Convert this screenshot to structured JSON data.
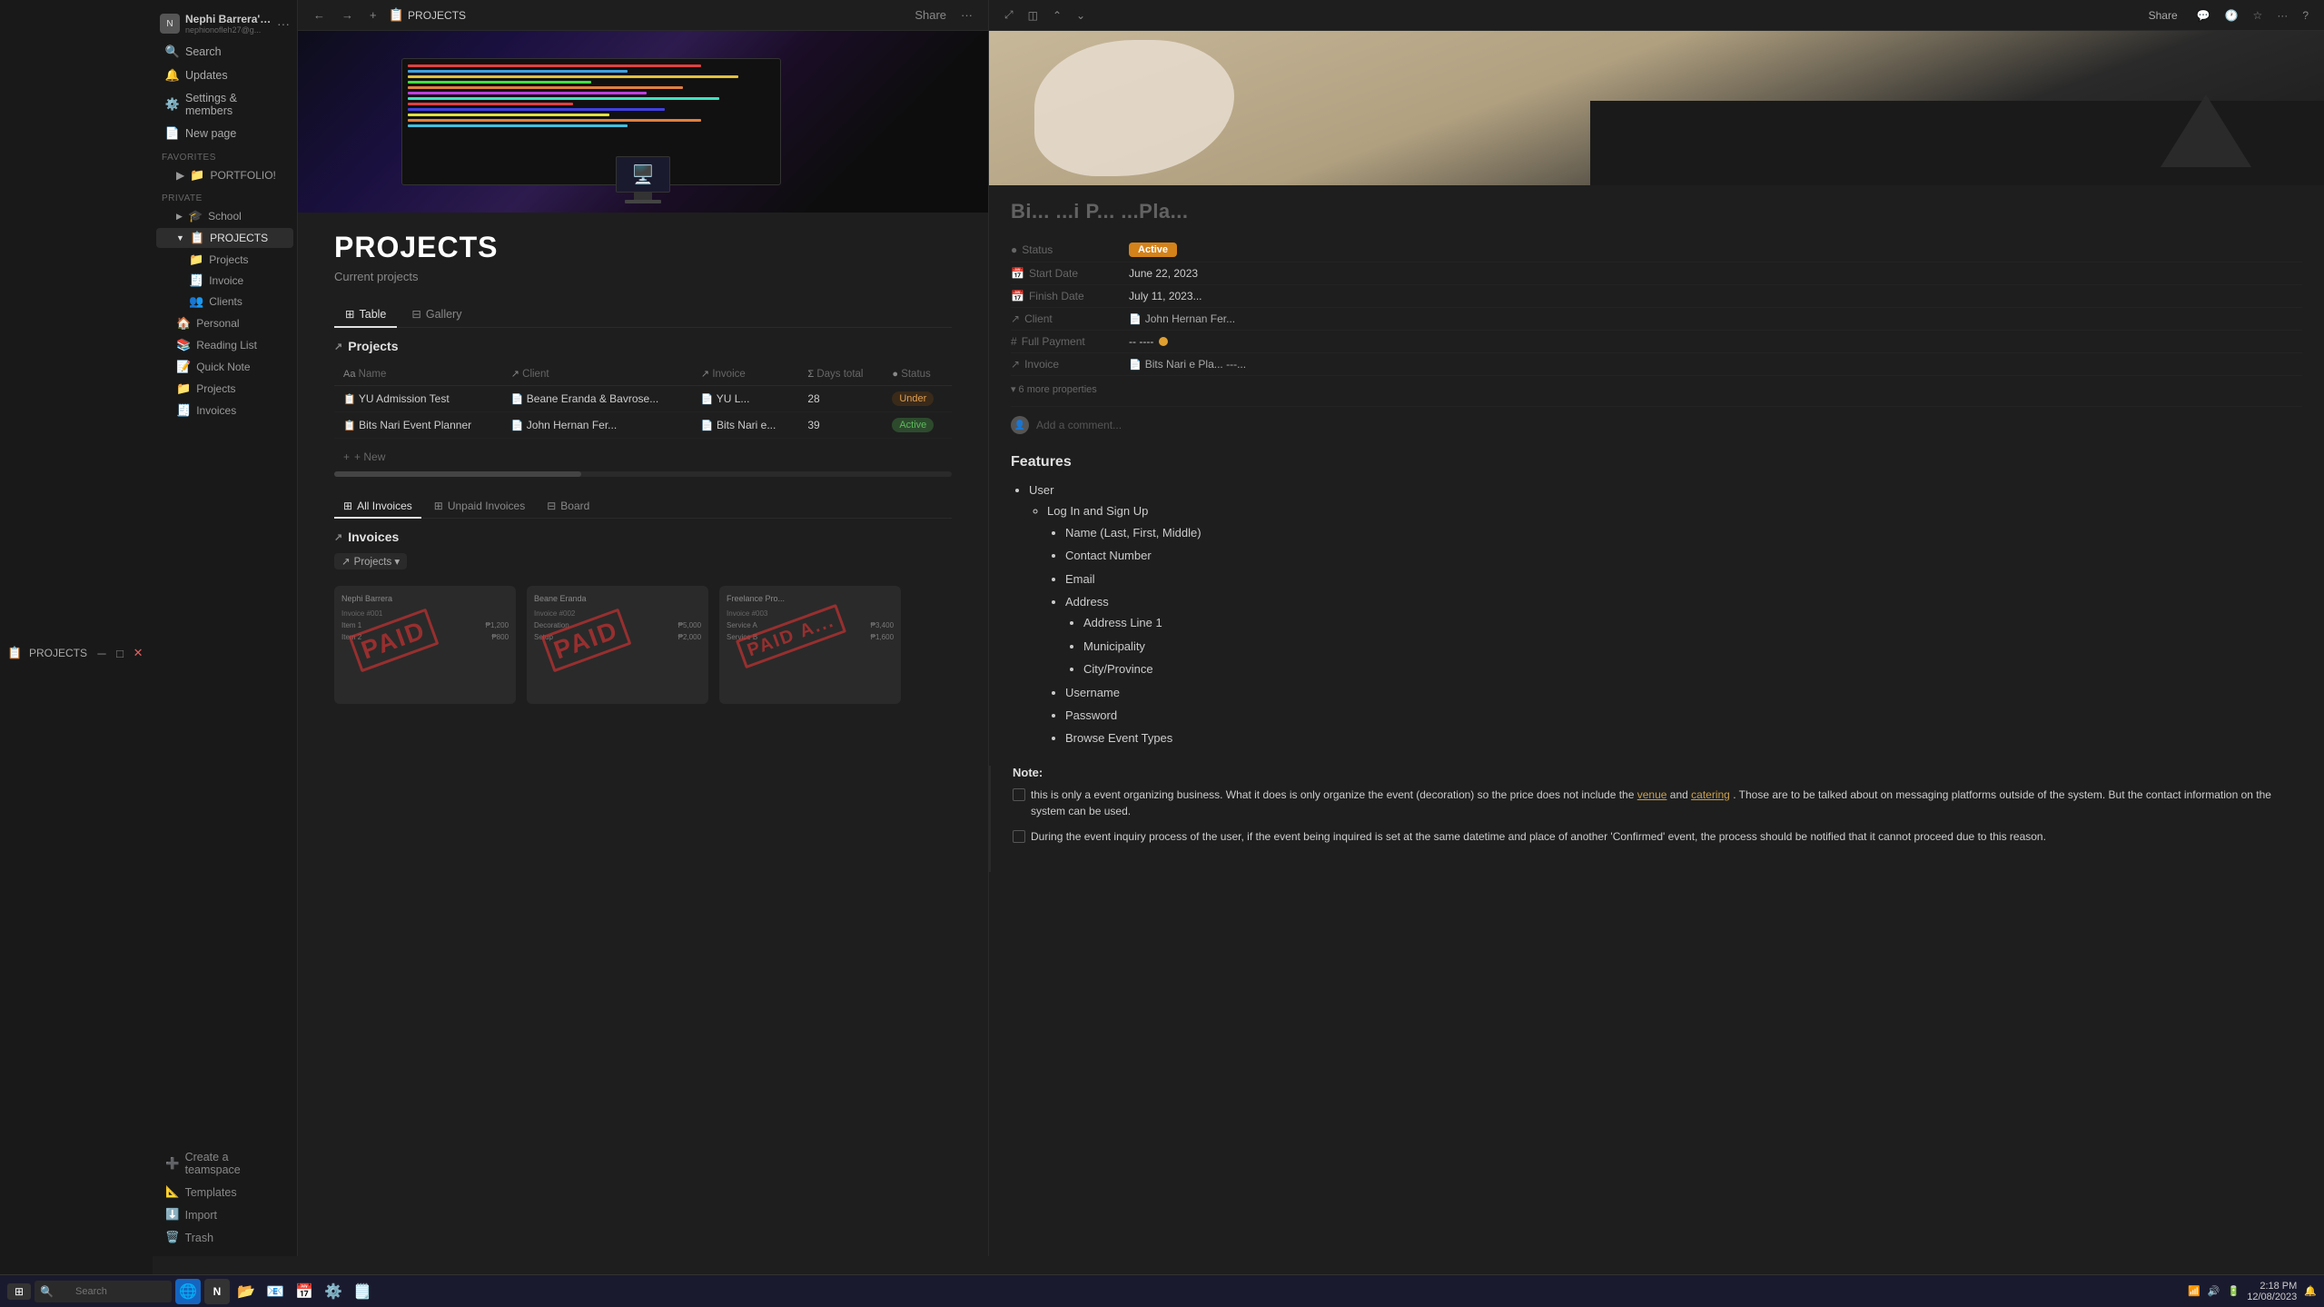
{
  "window": {
    "title": "PROJECTS",
    "app_name": "PROJECTS"
  },
  "sidebar": {
    "workspace": {
      "name": "Nephi Barrera's ...",
      "email": "nephionofleh27@g..."
    },
    "top_items": [
      {
        "id": "search",
        "label": "Search",
        "icon": "🔍"
      },
      {
        "id": "updates",
        "label": "Updates",
        "icon": "🔔"
      },
      {
        "id": "settings",
        "label": "Settings & members",
        "icon": "⚙️"
      },
      {
        "id": "new-page",
        "label": "New page",
        "icon": "📄"
      }
    ],
    "favorites_label": "Favorites",
    "favorites": [
      {
        "id": "portfolio",
        "label": "PORTFOLIO!",
        "icon": "📁"
      }
    ],
    "private_label": "Private",
    "private_items": [
      {
        "id": "school",
        "label": "School",
        "icon": "🎓"
      },
      {
        "id": "projects",
        "label": "PROJECTS",
        "icon": "📋",
        "active": true
      },
      {
        "id": "projects-sub",
        "label": "Projects",
        "icon": "📁"
      },
      {
        "id": "invoice",
        "label": "Invoice",
        "icon": "🧾"
      },
      {
        "id": "clients",
        "label": "Clients",
        "icon": "👥"
      },
      {
        "id": "personal",
        "label": "Personal",
        "icon": "🏠"
      },
      {
        "id": "reading-list",
        "label": "Reading List",
        "icon": "📚"
      },
      {
        "id": "quick-note",
        "label": "Quick Note",
        "icon": "📝"
      },
      {
        "id": "projects2",
        "label": "Projects",
        "icon": "📁"
      },
      {
        "id": "invoices",
        "label": "Invoices",
        "icon": "🧾"
      }
    ],
    "bottom_items": [
      {
        "id": "create-teamspace",
        "label": "Create a teamspace",
        "icon": "➕"
      },
      {
        "id": "templates",
        "label": "Templates",
        "icon": "📐"
      },
      {
        "id": "import",
        "label": "Import",
        "icon": "⬇️"
      },
      {
        "id": "trash",
        "label": "Trash",
        "icon": "🗑️"
      }
    ]
  },
  "toolbar": {
    "back_label": "←",
    "forward_label": "→",
    "plus_label": "+",
    "breadcrumb_icon": "📋",
    "breadcrumb_text": "PROJECTS",
    "share_label": "Share",
    "more_label": "···"
  },
  "left_panel": {
    "page_title": "PROJECTS",
    "page_subtitle": "Current projects",
    "table_tabs": [
      {
        "id": "table",
        "label": "Table",
        "icon": "⊞",
        "active": true
      },
      {
        "id": "gallery",
        "label": "Gallery",
        "icon": "⊟"
      }
    ],
    "projects_section": {
      "title": "Projects",
      "columns": [
        "Name",
        "Client",
        "Invoice",
        "Days total",
        "Status"
      ],
      "rows": [
        {
          "name": "YU Admission Test",
          "client": "Beane Eranda & Bavrose...",
          "invoice": "YU L...",
          "days": "28",
          "status": "Under",
          "status_type": "under"
        },
        {
          "name": "Bits Nari Event Planner",
          "client": "John Hernan Fer...",
          "invoice": "Bits Nari e...",
          "days": "39",
          "status": "Active",
          "status_type": "active"
        }
      ],
      "new_row_label": "+ New"
    },
    "invoices_section": {
      "title": "Invoices",
      "tabs": [
        {
          "id": "all",
          "label": "All Invoices",
          "icon": "⊞",
          "active": true
        },
        {
          "id": "unpaid",
          "label": "Unpaid Invoices",
          "icon": "⊞"
        },
        {
          "id": "board",
          "label": "Board",
          "icon": "⊟"
        }
      ],
      "filter_label": "Projects ▾",
      "cards": [
        {
          "id": 1,
          "stamp": "PAID"
        },
        {
          "id": 2,
          "stamp": "PAID"
        },
        {
          "id": 3,
          "stamp": "PAID A..."
        }
      ]
    }
  },
  "right_panel": {
    "page_title": "Bi... ...i P... ...Pla...",
    "properties": [
      {
        "label": "Status",
        "icon": "●",
        "value": "Active",
        "type": "status"
      },
      {
        "label": "Start Date",
        "icon": "📅",
        "value": "June 22, 2023",
        "type": "date"
      },
      {
        "label": "Finish Date",
        "icon": "📅",
        "value": "July 11, 2023...",
        "type": "date"
      },
      {
        "label": "Client",
        "icon": "↗",
        "value": "John Hernan Fer...",
        "type": "file"
      },
      {
        "label": "Full Payment",
        "icon": "#",
        "value": "-- ----",
        "type": "number"
      },
      {
        "label": "Invoice",
        "icon": "↗",
        "value": "Bits Nari e Pla... ---...",
        "type": "file"
      }
    ],
    "more_props_label": "6 more properties",
    "comment_placeholder": "Add a comment...",
    "features_title": "Features",
    "features": {
      "title": "Features",
      "items": [
        {
          "label": "User",
          "children": [
            {
              "label": "Log In and Sign Up",
              "children": [
                {
                  "label": "Name (Last, First, Middle)"
                },
                {
                  "label": "Contact Number"
                },
                {
                  "label": "Email"
                },
                {
                  "label": "Address",
                  "children": [
                    {
                      "label": "Address Line 1"
                    },
                    {
                      "label": "Municipality"
                    },
                    {
                      "label": "City/Province"
                    }
                  ]
                },
                {
                  "label": "Username"
                },
                {
                  "label": "Password"
                },
                {
                  "label": "Browse Event Types"
                }
              ]
            }
          ]
        }
      ]
    },
    "note": {
      "title": "Note:",
      "items": [
        {
          "checked": false,
          "text": "this is only a event organizing business. What it does is only organize the event (decoration) so the price does not include the venue and catering. Those are to be talked about on messaging platforms outside of the system. But the contact information on the system can be used."
        },
        {
          "checked": false,
          "text": "During the event inquiry process of the user, if the event being inquired is set at the same datetime and place of another 'Confirmed' event, the process should be notified that it cannot proceed due to this reason."
        }
      ]
    }
  },
  "taskbar": {
    "search_placeholder": "Search",
    "time": "2:18 PM",
    "date": "12/08/2023"
  }
}
